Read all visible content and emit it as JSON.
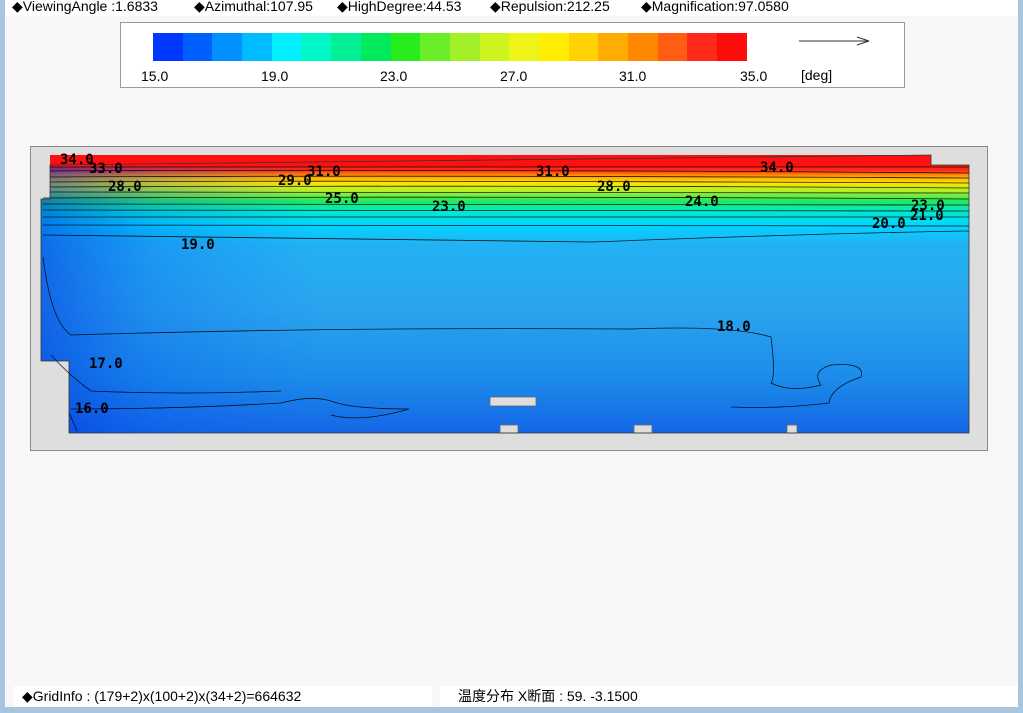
{
  "header": {
    "viewing_angle": "◆ViewingAngle :1.6833",
    "azimuthal": "◆Azimuthal:107.95",
    "high_degree": "◆HighDegree:44.53",
    "repulsion": "◆Repulsion:212.25",
    "magnification": "◆Magnification:97.0580"
  },
  "legend": {
    "colors": [
      "#0038ff",
      "#0060ff",
      "#0090ff",
      "#00bbff",
      "#00f0ff",
      "#00f7c8",
      "#00ef94",
      "#00ea5c",
      "#27ec1e",
      "#6aee28",
      "#a4f028",
      "#cdf41e",
      "#eff418",
      "#ffee00",
      "#ffd200",
      "#ffac00",
      "#ff8800",
      "#ff5c14",
      "#ff2a1a",
      "#ff0d0d"
    ],
    "labels": [
      "15.0",
      "19.0",
      "23.0",
      "27.0",
      "31.0",
      "35.0"
    ],
    "unit": "[deg]"
  },
  "contour_labels": [
    "34.0",
    "33.0",
    "28.0",
    "31.0",
    "29.0",
    "25.0",
    "23.0",
    "31.0",
    "28.0",
    "34.0",
    "24.0",
    "23.0",
    "21.0",
    "20.0",
    "19.0",
    "18.0",
    "17.0",
    "16.0"
  ],
  "status": {
    "grid_info": "◆GridInfo : (179+2)x(100+2)x(34+2)=664632",
    "section_info": "温度分布 X断面 : 59.  -3.1500"
  }
}
